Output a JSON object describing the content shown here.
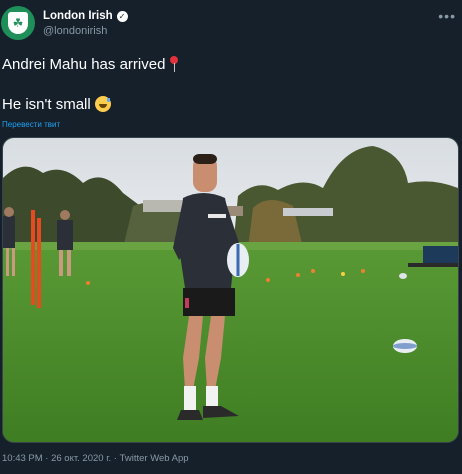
{
  "account": {
    "display_name": "London Irish",
    "handle": "@londonirish",
    "avatar_icon": "club-crest-icon",
    "verified_icon": "verified-badge-icon"
  },
  "tweet": {
    "line1": "Andrei Mahu has arrived",
    "line2": "He isn't small",
    "translate_link": "Перевести твит",
    "emoji1": "round-pushpin-icon",
    "emoji2": "grinning-sweat-icon"
  },
  "meta": {
    "text": "10:43 PM · 26 окт. 2020 г. · Twitter Web App"
  },
  "colors": {
    "background": "#15202b",
    "text": "#ffffff",
    "secondary": "#8899a6",
    "link": "#1da1f2"
  }
}
